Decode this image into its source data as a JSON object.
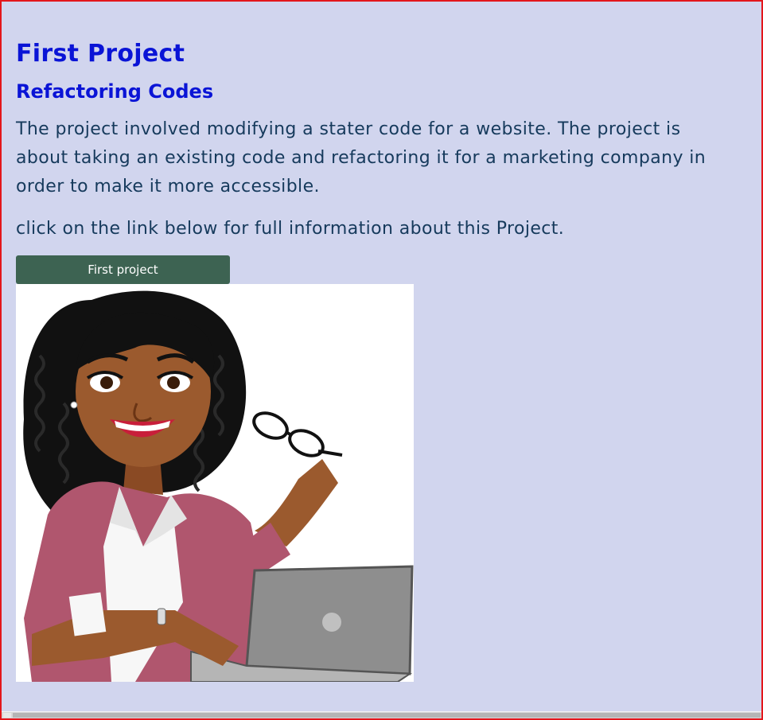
{
  "project": {
    "title": "First Project",
    "subtitle": "Refactoring Codes",
    "description": "The project involved modifying a stater code for a website. The project is about taking an existing code and refactoring it for a marketing company in order to make it more accessible.",
    "note": "click on the link below for full information about this Project.",
    "button_label": "First project"
  },
  "illustration": {
    "subject": "woman-with-laptop-illustration"
  },
  "colors": {
    "background": "#d1d5ee",
    "border": "#e3161c",
    "heading": "#0a14d6",
    "body_text": "#163a5c",
    "button": "#3d6352",
    "button_text": "#ffffff"
  }
}
